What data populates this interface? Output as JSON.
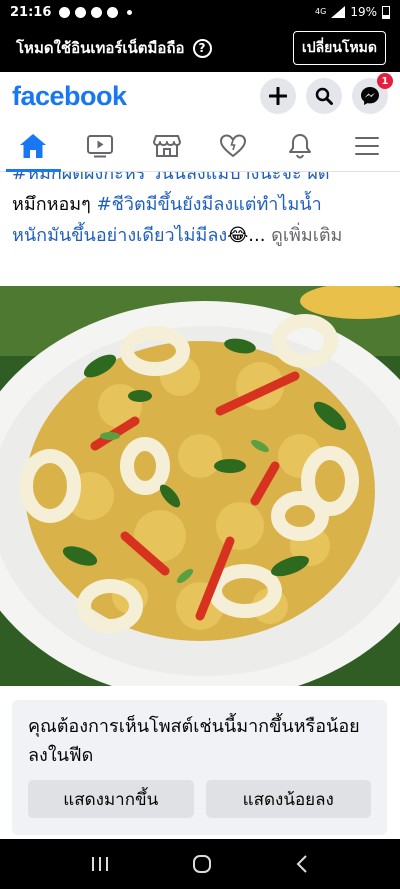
{
  "status_bar": {
    "time": "21:16",
    "network": "4G",
    "battery": "19%"
  },
  "mode_banner": {
    "message": "โหมดใช้อินเทอร์เน็ตมือถือ",
    "help": "?",
    "switch_label": "เปลี่ยนโหมด"
  },
  "header": {
    "logo": "facebook",
    "messenger_badge": "1",
    "icons": [
      "plus-icon",
      "search-icon",
      "messenger-icon"
    ]
  },
  "nav_tabs": [
    "home",
    "watch",
    "marketplace",
    "dating",
    "notifications",
    "menu"
  ],
  "post": {
    "line_cut": "#หมึกผัดผงกะหรี่ วันนี้ลงแม่บ้างนะจ๊ะ ผัด",
    "line2_plain": "หมึกหอมๆ ",
    "line2_tag": "#ชีวิตมีขึ้นยังมีลงแต่ทำไมน้ำ",
    "line3_tag": "หนักมันขึ้นอย่างเดียวไม่มีลง",
    "line3_emoji": "😂",
    "line3_more_prefix": "... ",
    "see_more": "ดูเพิ่มเติม"
  },
  "feed_pref": {
    "question": "คุณต้องการเห็นโพสต์เช่นนี้มากขึ้นหรือน้อยลงในฟีด",
    "more_label": "แสดงมากขึ้น",
    "less_label": "แสดงน้อยลง"
  },
  "colors": {
    "brand": "#1877f2",
    "link": "#1f5fbf",
    "badge": "#e41e3f"
  }
}
